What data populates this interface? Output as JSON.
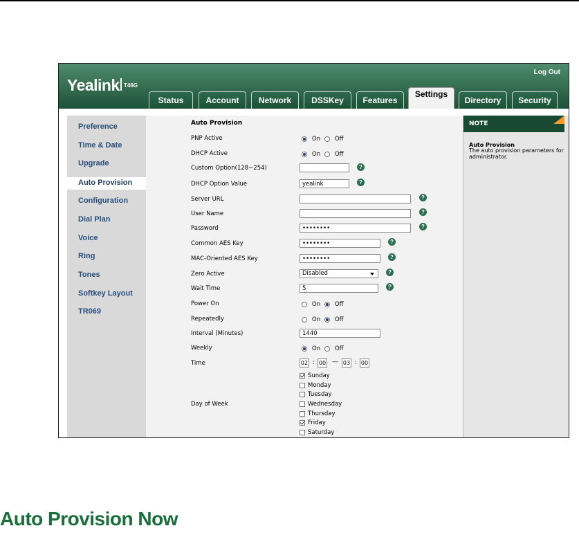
{
  "header": {
    "logo": "Yealink",
    "model": "T46G",
    "logout": "Log Out"
  },
  "tabs": [
    "Status",
    "Account",
    "Network",
    "DSSKey",
    "Features",
    "Settings",
    "Directory",
    "Security"
  ],
  "active_tab": "Settings",
  "sidebar": {
    "items": [
      "Preference",
      "Time & Date",
      "Upgrade",
      "Auto Provision",
      "Configuration",
      "Dial Plan",
      "Voice",
      "Ring",
      "Tones",
      "Softkey Layout",
      "TR069"
    ],
    "active": "Auto Provision"
  },
  "form": {
    "section_title": "Auto Provision",
    "pnp_active": {
      "label": "PNP Active",
      "on": "On",
      "off": "Off",
      "value": "On"
    },
    "dhcp_active": {
      "label": "DHCP Active",
      "on": "On",
      "off": "Off",
      "value": "On"
    },
    "custom_option": {
      "label": "Custom Option(128~254)",
      "value": ""
    },
    "dhcp_option_value": {
      "label": "DHCP Option Value",
      "value": "yealink"
    },
    "server_url": {
      "label": "Server URL",
      "value": ""
    },
    "user_name": {
      "label": "User Name",
      "value": ""
    },
    "password": {
      "label": "Password",
      "value": "••••••••"
    },
    "common_aes_key": {
      "label": "Common AES Key",
      "value": "••••••••"
    },
    "mac_aes_key": {
      "label": "MAC-Oriented AES Key",
      "value": "••••••••"
    },
    "zero_active": {
      "label": "Zero Active",
      "value": "Disabled"
    },
    "wait_time": {
      "label": "Wait Time",
      "value": "5"
    },
    "power_on": {
      "label": "Power On",
      "on": "On",
      "off": "Off",
      "value": "Off"
    },
    "repeatedly": {
      "label": "Repeatedly",
      "on": "On",
      "off": "Off",
      "value": "Off"
    },
    "interval": {
      "label": "Interval (Minutes)",
      "value": "1440"
    },
    "weekly": {
      "label": "Weekly",
      "on": "On",
      "off": "Off",
      "value": "On"
    },
    "time": {
      "label": "Time",
      "start_h": "02",
      "start_m": "00",
      "end_h": "03",
      "end_m": "00",
      "colon": ":",
      "dash": "—"
    },
    "day_of_week": {
      "label": "Day of Week",
      "days": [
        {
          "name": "Sunday",
          "checked": true
        },
        {
          "name": "Monday",
          "checked": false
        },
        {
          "name": "Tuesday",
          "checked": false
        },
        {
          "name": "Wednesday",
          "checked": false
        },
        {
          "name": "Thursday",
          "checked": false
        },
        {
          "name": "Friday",
          "checked": true
        },
        {
          "name": "Saturday",
          "checked": false
        }
      ]
    }
  },
  "help_glyph": "?",
  "note": {
    "heading": "NOTE",
    "title": "Auto Provision",
    "desc": "The auto provision parameters for administrator."
  },
  "page_heading": "Auto Provision Now",
  "colors": {
    "header_green": "#1c5237",
    "note_green": "#184a31",
    "heading_green": "#1a6e3a",
    "nav_blue": "#274e7a",
    "accent_orange": "#f59a23"
  }
}
